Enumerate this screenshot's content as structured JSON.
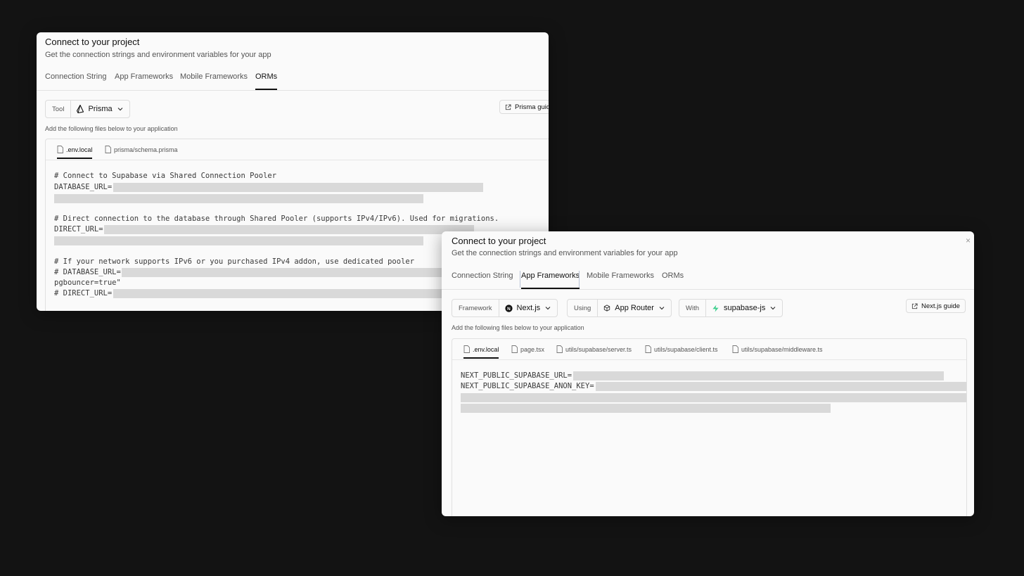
{
  "orms_dialog": {
    "title": "Connect to your project",
    "subtitle": "Get the connection strings and environment variables for your app",
    "tabs": [
      "Connection String",
      "App Frameworks",
      "Mobile Frameworks",
      "ORMs"
    ],
    "active_tab": "ORMs",
    "tool": {
      "label": "Tool",
      "value": "Prisma",
      "icon": "prisma-icon"
    },
    "guide_button": "Prisma guide",
    "hint": "Add the following files below to your application",
    "file_tabs": [
      ".env.local",
      "prisma/schema.prisma"
    ],
    "active_file": ".env.local",
    "code": {
      "comment1": "# Connect to Supabase via Shared Connection Pooler",
      "line_database_url": "DATABASE_URL=",
      "comment2": "# Direct connection to the database through Shared Pooler (supports IPv4/IPv6). Used for migrations.",
      "line_direct_url": "DIRECT_URL=",
      "comment3": "# If your network supports IPv6 or you purchased IPv4 addon, use dedicated pooler",
      "line_database_url_commented": "# DATABASE_URL=",
      "line_pgbouncer": "pgbouncer=true\"",
      "line_direct_url_commented": "# DIRECT_URL="
    }
  },
  "app_dialog": {
    "title": "Connect to your project",
    "subtitle": "Get the connection strings and environment variables for your app",
    "close_icon": "close-icon",
    "tabs": [
      "Connection String",
      "App Frameworks",
      "Mobile Frameworks",
      "ORMs"
    ],
    "active_tab": "App Frameworks",
    "framework": {
      "label": "Framework",
      "value": "Next.js",
      "icon": "nextjs-icon"
    },
    "using": {
      "label": "Using",
      "value": "App Router",
      "icon": "cube-icon"
    },
    "with": {
      "label": "With",
      "value": "supabase-js",
      "icon": "supabase-bolt-icon"
    },
    "guide_button": "Next.js guide",
    "hint": "Add the following files below to your application",
    "file_tabs": [
      ".env.local",
      "page.tsx",
      "utils/supabase/server.ts",
      "utils/supabase/client.ts",
      "utils/supabase/middleware.ts"
    ],
    "active_file": ".env.local",
    "code": {
      "line_url": "NEXT_PUBLIC_SUPABASE_URL=",
      "line_anon_key": "NEXT_PUBLIC_SUPABASE_ANON_KEY="
    }
  },
  "colors": {
    "background": "#131313",
    "panel": "#fafafa",
    "redaction": "#d9d9d9",
    "supabase_green": "#3ecf8e"
  }
}
